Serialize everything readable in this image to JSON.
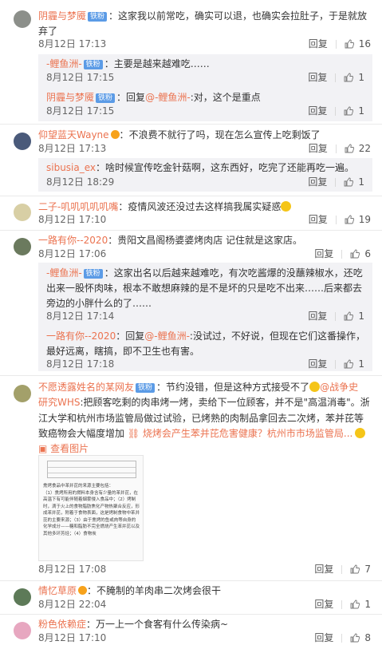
{
  "badge_label": "铁粉",
  "comments": [
    {
      "id": "c1",
      "user": "阴霾与梦魇",
      "has_badge": true,
      "text": "这家我以前常吃，确实可以退，也确实会拉肚子，于是就放",
      "text2": "弃了",
      "time": "8月12日 17:13",
      "reply": "回复",
      "likes": "16"
    },
    {
      "id": "c2",
      "user": "仰望蓝天Wayne",
      "has_badge": false,
      "text": "不浪费不就行了吗，现在怎么宣传上吃剩饭了",
      "time": "8月12日 17:13",
      "reply": "回复",
      "likes": "22"
    },
    {
      "id": "c3",
      "user": "二子-叽叽叽叽叽嘴",
      "has_badge": false,
      "text": "疫情风波还没过去这样搞我属实疑惑",
      "time": "8月12日 17:10",
      "reply": "回复",
      "likes": "19"
    },
    {
      "id": "c4",
      "user": "一路有你--2020",
      "has_badge": false,
      "text": "贵阳文昌阁杨婆婆烤肉店   记住就是这家店。",
      "time": "8月12日 17:06",
      "reply": "回复",
      "likes": "6"
    },
    {
      "id": "c5",
      "user": "不愿透露姓名的某网友",
      "has_badge": true,
      "line1": "节约没错，但是这种方式接受不了",
      "mention": "@战争史",
      "line2a": "研究WHS",
      "line2b": ":把顾客吃剩的肉串烤一烤，卖给下一位顾客，并不是\"高温消毒\"。浙",
      "line3": "江大学和杭州市场监管局做过试验，已烤熟的肉制品拿回去二次烤，苯并芘等",
      "line4": "致癌物会大幅度增加",
      "link": "烧烤会产生苯并芘危害健康？杭州市市场监管局...",
      "view_image": "查看图片",
      "time": "8月12日 17:08",
      "reply": "回复",
      "likes": "7"
    },
    {
      "id": "c6",
      "user": "情忆草原",
      "has_badge": false,
      "text": "不腌制的羊肉串二次烤会很干",
      "time": "8月12日 22:04",
      "reply": "回复",
      "likes": "1"
    },
    {
      "id": "c7",
      "user": "粉色依赖症",
      "has_badge": false,
      "text": "万一上一个食客有什么传染病~",
      "time": "8月12日 17:10",
      "reply": "回复",
      "likes": "8"
    }
  ],
  "replies": [
    {
      "id": "r1",
      "user": "-鲤鱼洲-",
      "has_badge": true,
      "text": "主要是越来越难吃……",
      "time": "8月12日 17:15",
      "reply": "回复",
      "likes": "1"
    },
    {
      "id": "r2",
      "user": "阴霾与梦魇",
      "has_badge": true,
      "prefix": "回复",
      "mention": "@-鲤鱼洲-",
      "text": ":对，这个是重点",
      "time": "8月12日 17:15",
      "reply": "回复",
      "likes": "1"
    },
    {
      "id": "r3",
      "user": "sibusia_ex",
      "has_badge": false,
      "text": "啥时候宣传吃金针菇啊，这东西好，吃完了还能再吃一遍。",
      "time": "8月12日 18:29",
      "reply": "回复",
      "likes": "1"
    },
    {
      "id": "r4",
      "user": "-鲤鱼洲-",
      "has_badge": true,
      "text": "这家出名以后越来越难吃，有次吃酱爆的没蘸辣椒水，还吃",
      "text2": "出来一股怀肉味，根本不敢想麻辣的是不是坏的只是吃不出来……后来都去",
      "text3": "旁边的小胖什么的了……",
      "time": "8月12日 17:14",
      "reply": "回复",
      "likes": "1"
    },
    {
      "id": "r5",
      "user": "一路有你--2020",
      "has_badge": false,
      "prefix": "回复",
      "mention": "@-鲤鱼洲-",
      "text": ":没试过，不好说，但现在它们这番操作，",
      "text2": "最好远离，瞎搞，即不卫生也有害。",
      "time": "8月12日 17:18",
      "reply": "回复",
      "likes": "1"
    }
  ],
  "image_text": {
    "title": "熏烤食品中苯并芘的来源主要包括：",
    "body": "（1）熏烤所用的燃料本身含有少量的苯并芘，在高温下有可能伴随着烟雾侵入食品中；（2）烤制时，滴于火上的食物脂肪焦化产物热聚合反应，形成苯并芘，附着于食物表面，这是烤制食物中苯并芘的主要来源；（3）由于熏烤的鱼或肉等自身的化学成分——糖和脂肪不完全燃烧产生苯并芘以及其他多环芳烃；（4）食物炭"
  },
  "colors": {
    "username": "#eb7350",
    "badge": "#5b9be6",
    "sub_bg": "#f2f2f5",
    "text": "#333333",
    "meta": "#666666"
  }
}
